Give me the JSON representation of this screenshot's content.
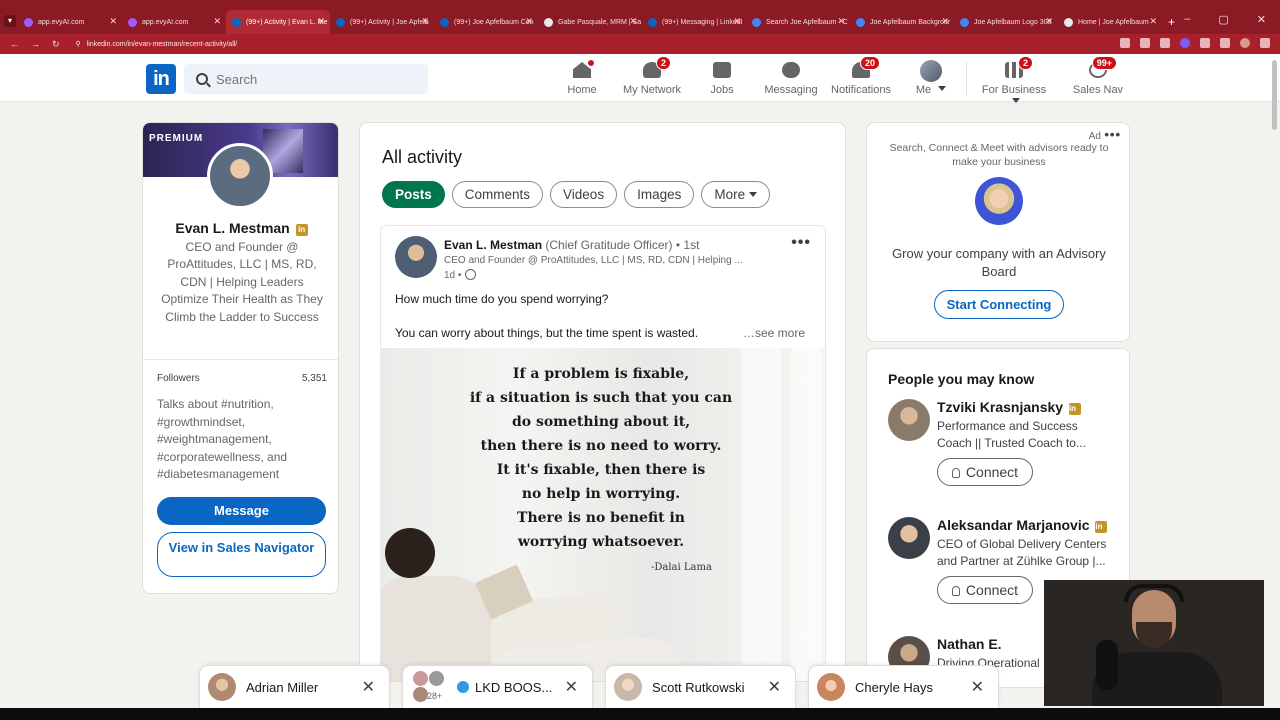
{
  "browser": {
    "tabs": [
      {
        "title": "app.evyAI.com",
        "color": "#a259ff",
        "active": false
      },
      {
        "title": "app.evyAI.com",
        "color": "#a259ff",
        "active": false
      },
      {
        "title": "(99+) Activity | Evan L. Me",
        "color": "#0a66c2",
        "active": true
      },
      {
        "title": "(99+) Activity | Joe Apfelb",
        "color": "#0a66c2",
        "active": false
      },
      {
        "title": "(99+) Joe Apfelbaum Con",
        "color": "#0a66c2",
        "active": false
      },
      {
        "title": "Gabe Pasquale, MRM | Sa",
        "color": "#e8e8e8",
        "active": false
      },
      {
        "title": "(99+) Messaging | LinkedI",
        "color": "#0a66c2",
        "active": false
      },
      {
        "title": "Search Joe Apfelbaum - C",
        "color": "#4285f4",
        "active": false
      },
      {
        "title": "Joe Apfelbaum Backgrour",
        "color": "#4285f4",
        "active": false
      },
      {
        "title": "Joe Apfelbaum Logo 300",
        "color": "#4285f4",
        "active": false
      },
      {
        "title": "Home | Joe Apfelbaum",
        "color": "#e8e8e8",
        "active": false
      }
    ],
    "url": "linkedin.com/in/evan-mestman/recent-activity/all/",
    "new_tab_label": "+",
    "window_controls": [
      "–",
      "▢",
      "✕"
    ]
  },
  "nav": {
    "logo_text": "in",
    "search_placeholder": "Search",
    "items": [
      {
        "label": "Home",
        "icon": "home-icon",
        "badge": ""
      },
      {
        "label": "My Network",
        "icon": "network-icon",
        "badge": "2"
      },
      {
        "label": "Jobs",
        "icon": "jobs-icon",
        "badge": ""
      },
      {
        "label": "Messaging",
        "icon": "messaging-icon",
        "badge": ""
      },
      {
        "label": "Notifications",
        "icon": "bell-icon",
        "badge": "20"
      },
      {
        "label": "Me",
        "icon": "avatar",
        "badge": ""
      },
      {
        "label": "For Business",
        "icon": "grid-icon",
        "badge": "2"
      },
      {
        "label": "Sales Nav",
        "icon": "compass-icon",
        "badge": "99+"
      }
    ]
  },
  "profile": {
    "banner_label": "PREMIUM",
    "name": "Evan L. Mestman",
    "title": "CEO and Founder @ ProAttitudes, LLC | MS, RD, CDN | Helping Leaders Optimize Their Health as They Climb the Ladder to Success",
    "followers_label": "Followers",
    "followers_count": "5,351",
    "talks_about": "Talks about #nutrition, #growthmindset, #weightmanagement, #corporatewellness, and #diabetesmanagement",
    "message_button": "Message",
    "sales_button": "View in Sales Navigator"
  },
  "activity": {
    "title": "All activity",
    "filters": [
      "Posts",
      "Comments",
      "Videos",
      "Images",
      "More"
    ],
    "active_filter": "Posts",
    "post": {
      "author": "Evan L. Mestman",
      "role": "(Chief Gratitude Officer)",
      "degree": "• 1st",
      "headline": "CEO and Founder @ ProAttitudes, LLC | MS, RD, CDN | Helping ...",
      "time": "1d •",
      "text_line1": "How much time do you spend worrying?",
      "text_line2": "You can worry about things, but the time spent is wasted.",
      "see_more": "…see more",
      "quote_lines": [
        "If a problem is fixable,",
        "if a situation is such that you can",
        "do something about it,",
        "then there is no need to worry.",
        "It it's fixable, then there is",
        "no help in worrying.",
        "There is no benefit in",
        "worrying whatsoever."
      ],
      "quote_author": "-Dalai Lama"
    }
  },
  "ad": {
    "label": "Ad",
    "text": "Search, Connect & Meet with advisors ready to make your business",
    "headline": "Grow your company with an Advisory Board",
    "button": "Start Connecting"
  },
  "people": {
    "title": "People you may know",
    "connect_label": "Connect",
    "list": [
      {
        "name": "Tzviki Krasnjansky",
        "desc": "Performance and Success Coach || Trusted Coach to...",
        "color": "#8a7a6a",
        "premium": true
      },
      {
        "name": "Aleksandar Marjanovic",
        "desc": "CEO of Global Delivery Centers and Partner at Zühlke Group |...",
        "color": "#3b3f47",
        "premium": true
      },
      {
        "name": "Nathan E.",
        "desc": "Driving Operational",
        "color": "#5a4f48",
        "premium": false
      }
    ]
  },
  "messaging": [
    {
      "name": "Adrian Miller",
      "color": "#b08a70"
    },
    {
      "name": "LKD BOOS...",
      "count": "28+"
    },
    {
      "name": "Scott Rutkowski",
      "color": "#c9b8a8"
    },
    {
      "name": "Cheryle Hays",
      "color": "#c9865e"
    }
  ]
}
